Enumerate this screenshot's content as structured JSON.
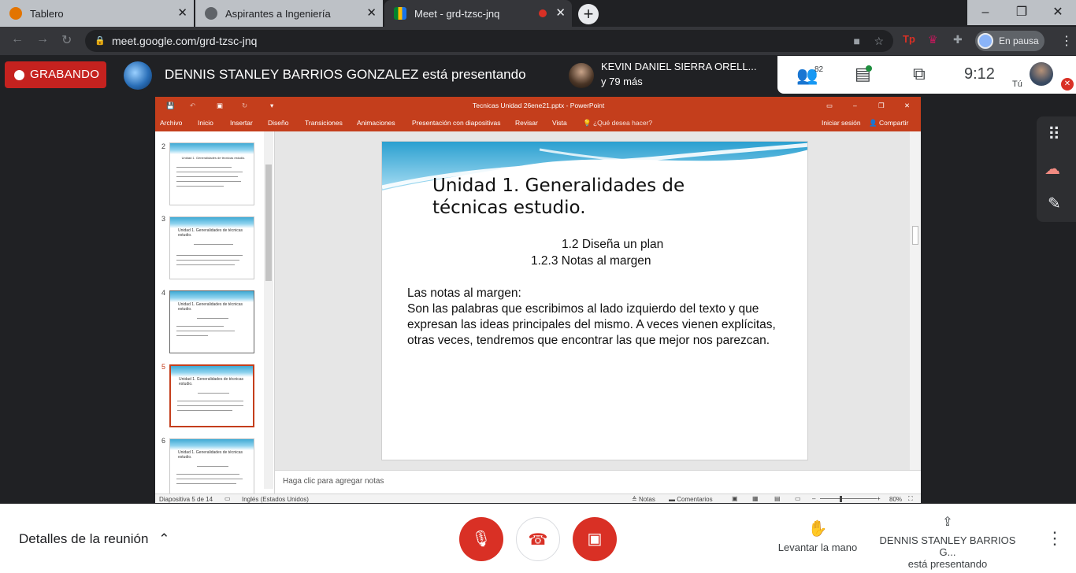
{
  "browser": {
    "tabs": [
      {
        "title": "Tablero"
      },
      {
        "title": "Aspirantes a Ingeniería"
      },
      {
        "title": "Meet - grd-tzsc-jnq"
      }
    ],
    "url": "meet.google.com/grd-tzsc-jnq",
    "profile_label": "En pausa"
  },
  "meet": {
    "recording_label": "GRABANDO",
    "presenting_text": "DENNIS STANLEY BARRIOS GONZALEZ está presentando",
    "participant_name": "KEVIN DANIEL SIERRA ORELL...",
    "participant_more": "y 79 más",
    "people_count": "82",
    "time": "9:12",
    "self_label": "Tú",
    "details_label": "Detalles de la reunión",
    "raise_hand_label": "Levantar la mano",
    "presenter_label_line1": "DENNIS STANLEY BARRIOS G...",
    "presenter_label_line2": "está presentando",
    "colors": {
      "recording": "#c5221f",
      "danger": "#d93025",
      "ppt": "#c43e1c"
    }
  },
  "powerpoint": {
    "window_title": "Tecnicas Unidad 26ene21.pptx - PowerPoint",
    "ribbon_tabs": [
      "Archivo",
      "Inicio",
      "Insertar",
      "Diseño",
      "Transiciones",
      "Animaciones",
      "Presentación con diapositivas",
      "Revisar",
      "Vista"
    ],
    "tell_me": "¿Qué desea hacer?",
    "sign_in": "Iniciar sesión",
    "share": "Compartir",
    "thumbnails": [
      {
        "number": "2",
        "title": "Unidad 1. Generalidades de técnicas estudio."
      },
      {
        "number": "3",
        "title": "Unidad 1. Generalidades de técnicas estudio."
      },
      {
        "number": "4",
        "title": "Unidad 1. Generalidades de técnicas estudio."
      },
      {
        "number": "5",
        "title": "Unidad 1. Generalidades de técnicas estudio."
      },
      {
        "number": "6",
        "title": "Unidad 1. Generalidades de técnicas estudio."
      }
    ],
    "slide": {
      "title_line1": "Unidad 1. Generalidades de",
      "title_line2": "técnicas estudio.",
      "sub1": "1.2 Diseña un plan",
      "sub2": "1.2.3 Notas al margen",
      "body_heading": "Las notas al margen:",
      "body_text": "Son las palabras que escribimos al lado izquierdo del texto y que expresan las ideas principales del mismo. A veces vienen explícitas, otras veces, tendremos que encontrar las que mejor nos parezcan."
    },
    "notes_placeholder": "Haga clic para agregar notas",
    "status": {
      "slide_of": "Diapositiva 5 de 14",
      "language": "Inglés (Estados Unidos)",
      "notes": "Notas",
      "comments": "Comentarios",
      "zoom": "80%"
    }
  }
}
